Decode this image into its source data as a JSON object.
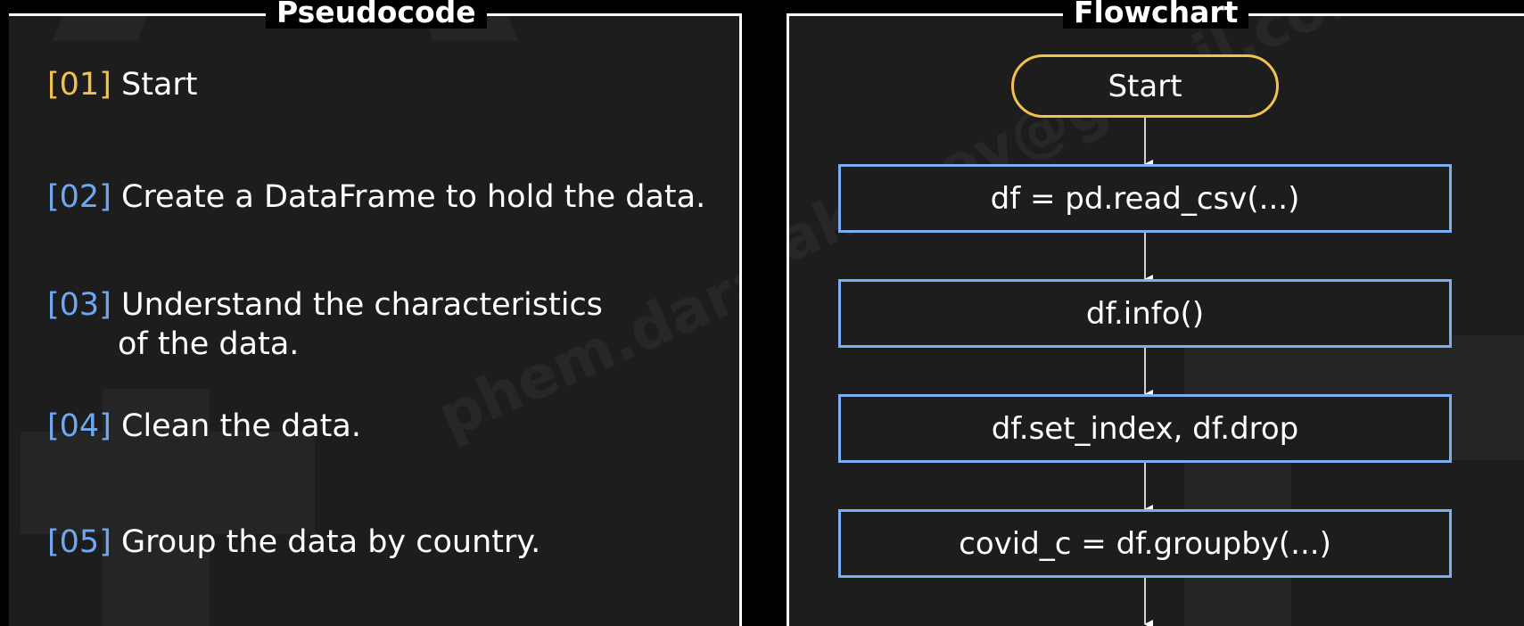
{
  "pseudocode": {
    "title": "Pseudocode",
    "steps": [
      {
        "num": "[01]",
        "text": "Start",
        "cont": "",
        "color": "#f2c14e"
      },
      {
        "num": "[02]",
        "text": "Create a DataFrame to hold the data.",
        "cont": "",
        "color": "#6fa8f0"
      },
      {
        "num": "[03]",
        "text": "Understand the characteristics",
        "cont": "of the data.",
        "color": "#6fa8f0"
      },
      {
        "num": "[04]",
        "text": "Clean the data.",
        "cont": "",
        "color": "#6fa8f0"
      },
      {
        "num": "[05]",
        "text": "Group the data by country.",
        "cont": "",
        "color": "#6fa8f0"
      }
    ]
  },
  "flowchart": {
    "title": "Flowchart",
    "start": "Start",
    "boxes": [
      "df = pd.read_csv(...)",
      "df.info()",
      "df.set_index, df.drop",
      "covid_c = df.groupby(...)"
    ]
  },
  "colors": {
    "start_border": "#f2c14e",
    "box_border": "#7aaef0",
    "step_number": "#6fa8f0",
    "first_step_number": "#f2c14e"
  },
  "watermark": "phem.dararaksmey@gmail.com"
}
